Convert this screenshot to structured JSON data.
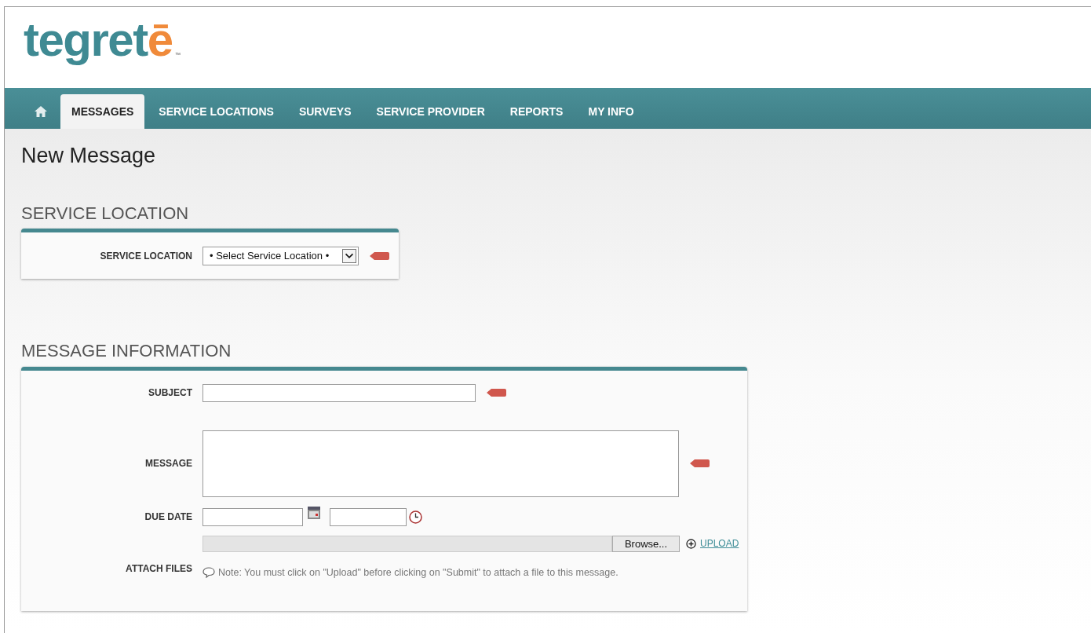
{
  "logo": {
    "main": "tegret",
    "accent": "ē",
    "trademark": "™"
  },
  "nav": {
    "tabs": [
      {
        "kind": "home",
        "selected": false
      },
      {
        "label": "MESSAGES",
        "selected": true
      },
      {
        "label": "SERVICE LOCATIONS",
        "selected": false
      },
      {
        "label": "SURVEYS",
        "selected": false
      },
      {
        "label": "SERVICE PROVIDER",
        "selected": false
      },
      {
        "label": "REPORTS",
        "selected": false
      },
      {
        "label": "MY INFO",
        "selected": false
      }
    ]
  },
  "page_title": "New Message",
  "service_location": {
    "heading": "SERVICE LOCATION",
    "label": "SERVICE LOCATION",
    "value": "• Select Service Location •",
    "required": true
  },
  "message_information": {
    "heading": "MESSAGE INFORMATION",
    "subject": {
      "label": "SUBJECT",
      "required": true
    },
    "message": {
      "label": "MESSAGE",
      "required": true
    },
    "due_date": {
      "label": "DUE DATE"
    },
    "attach_files": {
      "label": "ATTACH FILES",
      "browse": "Browse...",
      "upload": "UPLOAD",
      "note": "Note: You must click on \"Upload\" before clicking on \"Submit\" to attach a file to this message."
    }
  }
}
